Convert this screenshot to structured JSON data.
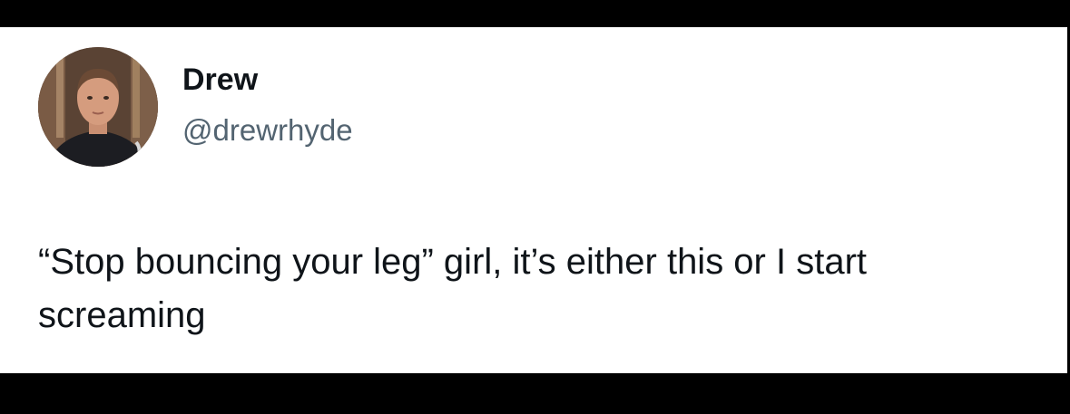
{
  "tweet": {
    "author": {
      "display_name": "Drew",
      "handle": "@drewrhyde"
    },
    "text": "“Stop bouncing your leg” girl, it’s either this or I start screaming"
  },
  "colors": {
    "background": "#000000",
    "card": "#ffffff",
    "name_text": "#0f1419",
    "handle_text": "#536471",
    "body_text": "#0f1419"
  },
  "icons": {
    "avatar": "profile-photo"
  }
}
